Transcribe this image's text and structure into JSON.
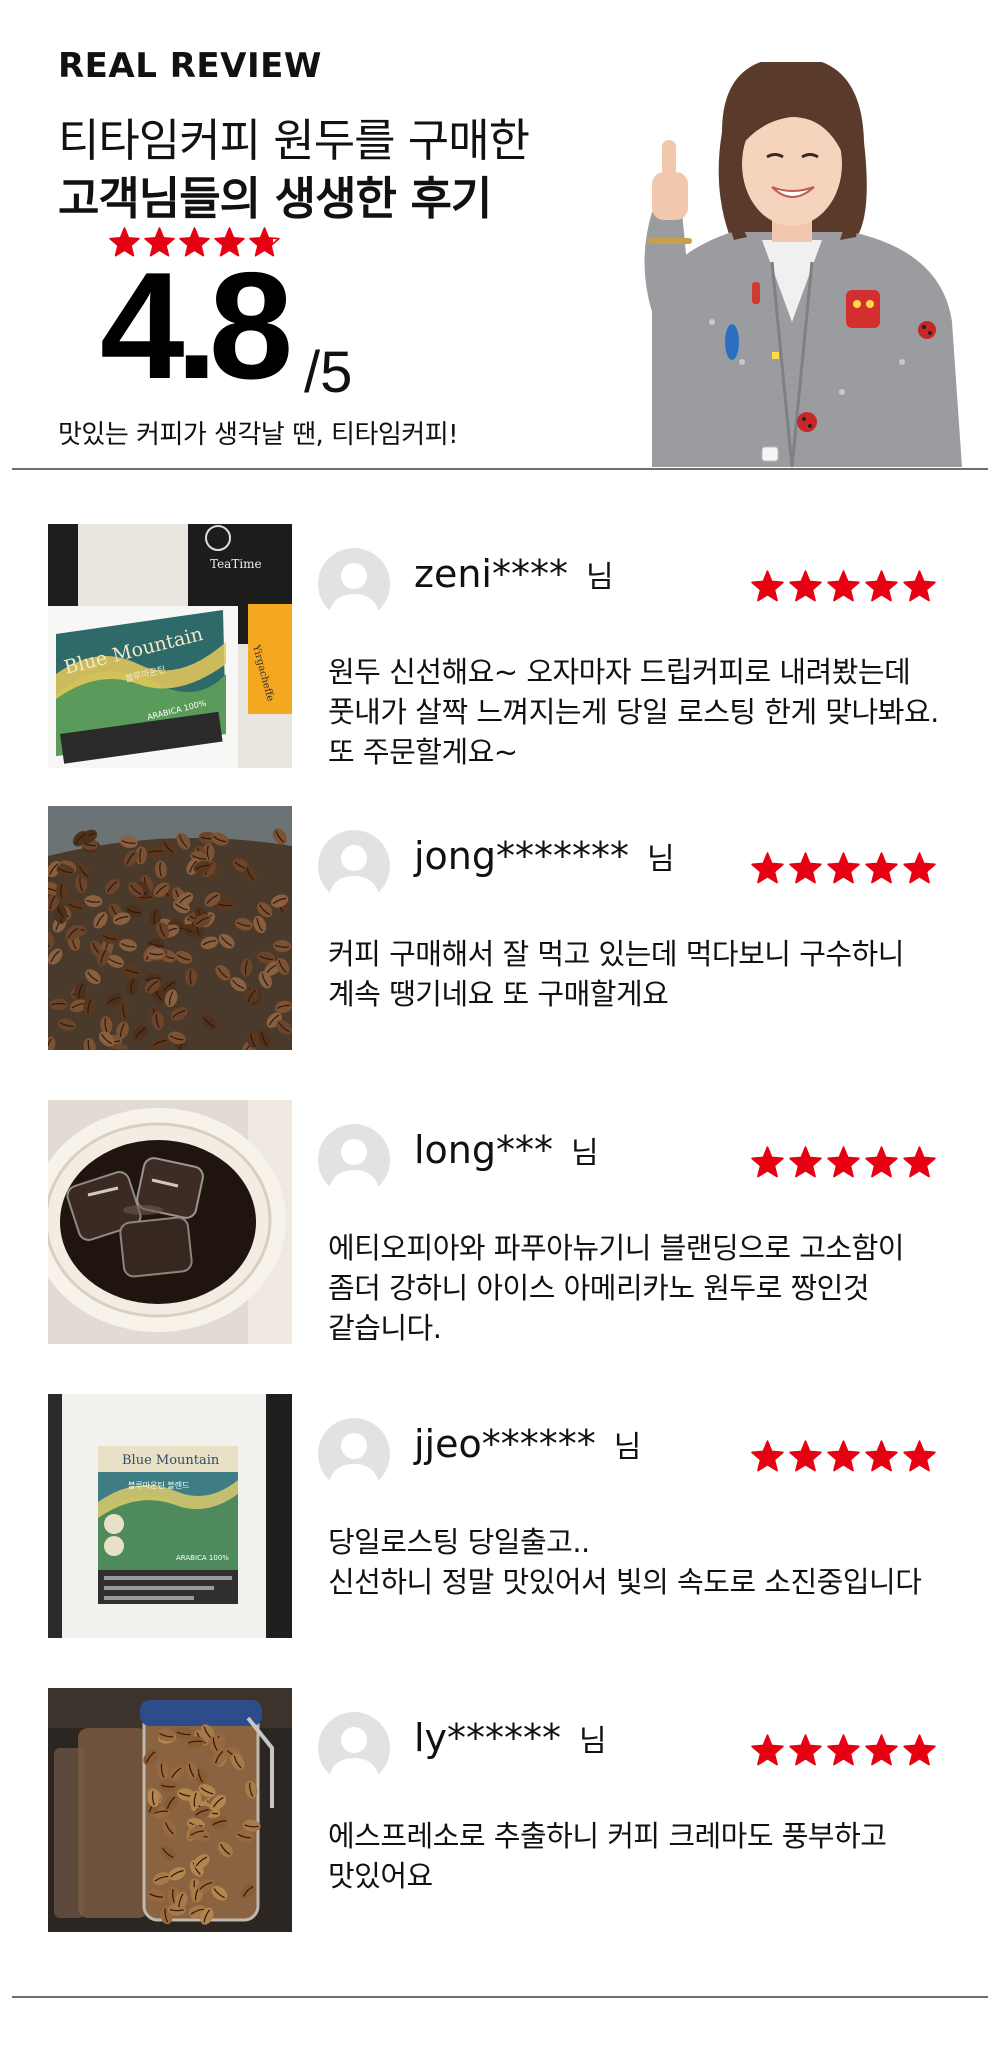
{
  "header": {
    "eyebrow": "REAL REVIEW",
    "headline_line1": "티타임커피 원두를 구매한",
    "headline_line2": "고객님들의 생생한 후기",
    "rating_stars": 4.8,
    "score": "4.8",
    "score_max": "/5",
    "tagline": "맛있는 커피가 생각날 땐, 티타임커피!"
  },
  "colors": {
    "star": "#e60012",
    "divider": "#6f6f6f",
    "avatar": "#e2e2e2"
  },
  "reviews": [
    {
      "user": "zeni****",
      "suffix": "님",
      "stars": 5,
      "lines": [
        "원두 신선해요~ 오자마자 드립커피로 내려봤는데",
        "풋내가 살짝 느껴지는게 당일 로스팅 한게 맞나봐요.",
        "또 주문할게요~"
      ],
      "photo": {
        "subject": "Blue Mountain coffee bag",
        "label": "Blue Mountain",
        "sublabel": "블루마운틴",
        "bag_label": "TeaTime",
        "side_label": "Yirgacheffe",
        "cert": "ARABICA 100%"
      }
    },
    {
      "user": "jong*******",
      "suffix": "님",
      "stars": 5,
      "lines": [
        "커피 구매해서 잘 먹고 있는데 먹다보니 구수하니",
        "계속 땡기네요 또 구매할게요"
      ],
      "photo": {
        "subject": "roasted coffee beans"
      }
    },
    {
      "user": "long***",
      "suffix": "님",
      "stars": 5,
      "lines": [
        "에티오피아와 파푸아뉴기니 블랜딩으로 고소함이",
        "좀더 강하니 아이스 아메리카노 원두로 짱인것",
        "같습니다."
      ],
      "photo": {
        "subject": "iced americano in paper cup"
      }
    },
    {
      "user": "jjeo******",
      "suffix": "님",
      "stars": 5,
      "lines": [
        "당일로스팅 당일출고..",
        "신선하니 정말 맛있어서 빛의 속도로 소진중입니다"
      ],
      "photo": {
        "subject": "Blue Mountain blend bag",
        "label": "Blue Mountain",
        "sublabel": "블루마운틴 블렌드",
        "cert": "ARABICA 100%"
      }
    },
    {
      "user": "ly******",
      "suffix": "님",
      "stars": 5,
      "lines": [
        "에스프레소로 추출하니 커피 크레마도 풍부하고",
        "맛있어요"
      ],
      "photo": {
        "subject": "coffee beans in glass jars"
      }
    }
  ]
}
